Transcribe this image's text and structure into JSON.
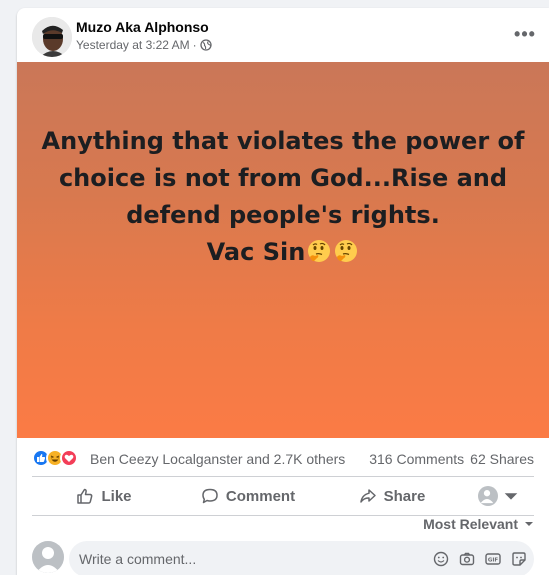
{
  "post": {
    "author": "Muzo Aka Alphonso",
    "timestamp": "Yesterday at 3:22 AM",
    "separator": "·",
    "privacy_icon": "globe-icon",
    "more_label": "•••",
    "text_lines": [
      "Anything that violates the power of",
      "choice is not from God...Rise and",
      "defend people's rights.",
      "Vac Sin"
    ],
    "emoji": "thinking-face-icon",
    "background_colors": [
      "#ca7758",
      "#fb7b45"
    ]
  },
  "reactions": {
    "icons": [
      "like-icon",
      "haha-icon",
      "love-icon"
    ],
    "summary": "Ben Ceezy Localganster and 2.7K others",
    "comments": "316 Comments",
    "shares": "62 Shares"
  },
  "actions": {
    "like": "Like",
    "comment": "Comment",
    "share": "Share"
  },
  "comments_section": {
    "sort_label": "Most Relevant",
    "input_placeholder": "Write a comment...",
    "tools": [
      "emoji-icon",
      "camera-icon",
      "gif-icon",
      "sticker-icon"
    ]
  },
  "colors": {
    "accent": "#1877f2",
    "secondary_text": "#65676b"
  }
}
